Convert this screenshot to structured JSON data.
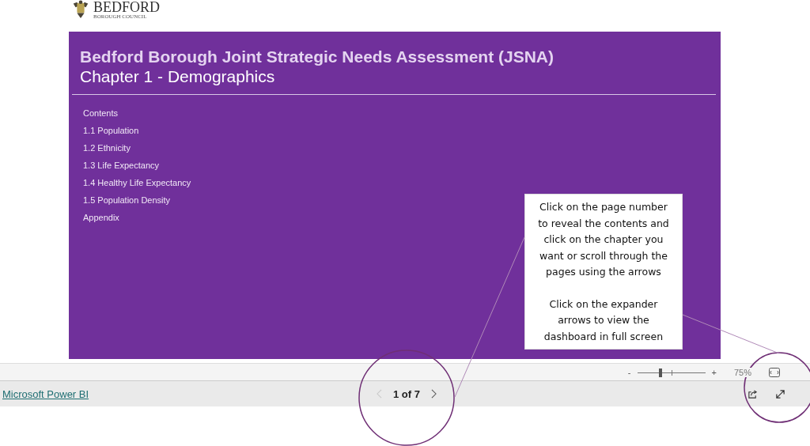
{
  "logo": {
    "name": "BEDFORD",
    "subtitle": "BOROUGH COUNCIL"
  },
  "report": {
    "title": "Bedford Borough Joint Strategic Needs Assessment (JSNA)",
    "subtitle": "Chapter 1 - Demographics",
    "contents_heading": "Contents",
    "contents": [
      "1.1 Population",
      "1.2 Ethnicity",
      "1.3 Life Expectancy",
      "1.4 Healthy Life Expectancy",
      "1.5 Population Density",
      "Appendix"
    ]
  },
  "callout": {
    "paragraphs": [
      "Click on the page number to reveal the contents and click on the chapter you want or scroll through the pages using the arrows",
      "Click on the expander arrows to view the dashboard in full screen"
    ]
  },
  "zoom_bar": {
    "minus": "-",
    "plus": "+",
    "level": 0.35,
    "percent": "75%"
  },
  "footer": {
    "link": "Microsoft Power BI",
    "page": "1 of 7",
    "prev_disabled": true
  }
}
